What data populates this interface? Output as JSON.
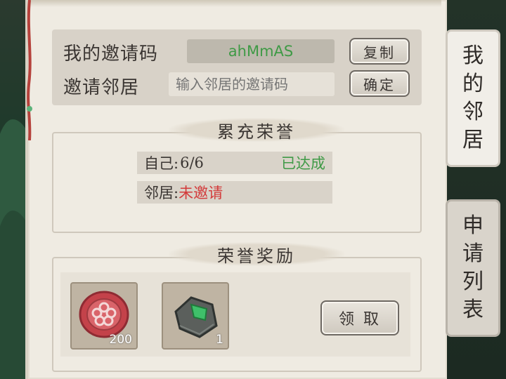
{
  "invite": {
    "my_code_label": "我的邀请码",
    "my_code_value": "ahMmAS",
    "copy_button": "复制",
    "invite_label": "邀请邻居",
    "invite_placeholder": "输入邻居的邀请码",
    "confirm_button": "确定"
  },
  "cumulative": {
    "title": "累充荣誉",
    "self_label": "自己:",
    "self_progress": "6/6",
    "self_status": "已达成",
    "neighbor_label": "邻居:",
    "neighbor_status": "未邀请"
  },
  "rewards": {
    "title": "荣誉奖励",
    "items": [
      {
        "icon": "flower-coin-icon",
        "count": "200"
      },
      {
        "icon": "jade-stone-icon",
        "count": "1"
      }
    ],
    "claim_button": "领 取"
  },
  "tabs": [
    {
      "label": "我的邻居",
      "chars": [
        "我",
        "的",
        "邻",
        "居"
      ],
      "active": true
    },
    {
      "label": "申请列表",
      "chars": [
        "申",
        "请",
        "列",
        "表"
      ],
      "active": false
    }
  ],
  "colors": {
    "success": "#3f9a46",
    "warning": "#d33a3a",
    "paper": "#efebe2"
  }
}
